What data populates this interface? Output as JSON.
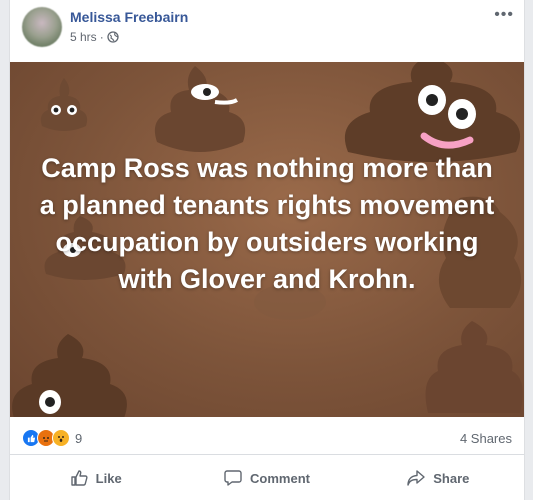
{
  "post": {
    "author": "Melissa Freebairn",
    "time": "5 hrs",
    "separator": "·",
    "image_text": "Camp Ross was nothing more than a planned tenants rights movement occupation by outsiders working with Glover and Krohn.",
    "reaction_count": "9",
    "shares": "4 Shares"
  },
  "actions": {
    "like": "Like",
    "comment": "Comment",
    "share": "Share"
  },
  "icons": {
    "more": "more-options-icon",
    "privacy": "globe-icon",
    "reactions": [
      "like-reaction-icon",
      "angry-reaction-icon",
      "wow-reaction-icon"
    ]
  },
  "colors": {
    "name": "#385898",
    "like_reaction": "#1877f2",
    "image_bg": "#7d543a"
  }
}
